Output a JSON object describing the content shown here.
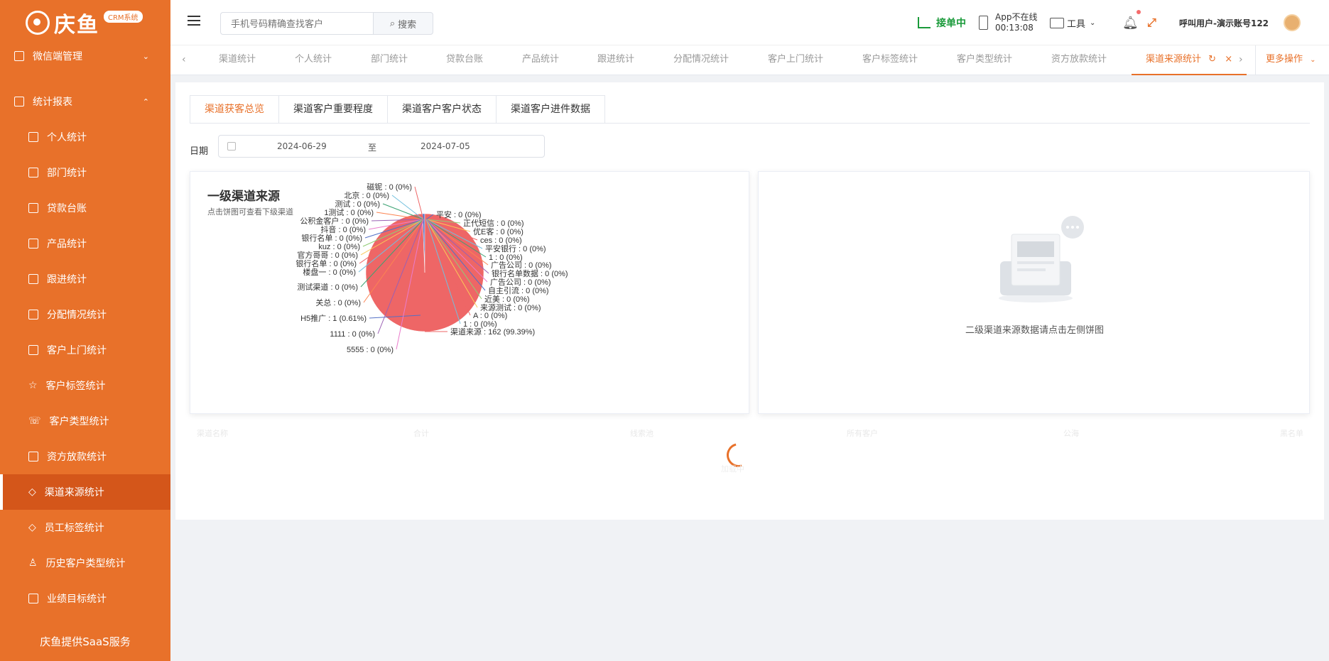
{
  "sidebar": {
    "brand": "庆鱼",
    "badge": "CRM系统",
    "groups": [
      {
        "label": "微信端管理",
        "arrow": "⌄"
      },
      {
        "label": "统计报表",
        "arrow": "⌃"
      }
    ],
    "items": [
      {
        "label": "个人统计"
      },
      {
        "label": "部门统计"
      },
      {
        "label": "贷款台账"
      },
      {
        "label": "产品统计"
      },
      {
        "label": "跟进统计"
      },
      {
        "label": "分配情况统计"
      },
      {
        "label": "客户上门统计"
      },
      {
        "label": "客户标签统计"
      },
      {
        "label": "客户类型统计"
      },
      {
        "label": "资方放款统计"
      },
      {
        "label": "渠道来源统计"
      },
      {
        "label": "员工标签统计"
      },
      {
        "label": "历史客户类型统计"
      },
      {
        "label": "业绩目标统计"
      }
    ],
    "footer": "庆鱼提供SaaS服务"
  },
  "header": {
    "search_placeholder": "手机号码精确查找客户",
    "search_button": "搜索",
    "status": "接单中",
    "app_status_line1": "App不在线",
    "app_status_line2": "00:13:08",
    "tools": "工具",
    "user": "呼叫用户-演示账号122"
  },
  "tabs": {
    "items": [
      {
        "label": "渠道统计"
      },
      {
        "label": "个人统计"
      },
      {
        "label": "部门统计"
      },
      {
        "label": "贷款台账"
      },
      {
        "label": "产品统计"
      },
      {
        "label": "跟进统计"
      },
      {
        "label": "分配情况统计"
      },
      {
        "label": "客户上门统计"
      },
      {
        "label": "客户标签统计"
      },
      {
        "label": "客户类型统计"
      },
      {
        "label": "资方放款统计"
      },
      {
        "label": "渠道来源统计"
      }
    ],
    "more": "更多操作"
  },
  "content": {
    "subtabs": [
      {
        "label": "渠道获客总览"
      },
      {
        "label": "渠道客户重要程度"
      },
      {
        "label": "渠道客户客户状态"
      },
      {
        "label": "渠道客户进件数据"
      }
    ],
    "date_label": "日期",
    "date_start": "2024-06-29",
    "date_sep": "至",
    "date_end": "2024-07-05",
    "chart_title": "一级渠道来源",
    "chart_subtitle": "点击饼图可查看下级渠道",
    "empty_text": "二级渠道来源数据请点击左侧饼图",
    "table_headers": [
      "渠道名称",
      "合计",
      "线索池",
      "所有客户",
      "公海",
      "黑名单"
    ],
    "loading_text": "加载中"
  },
  "chart_data": {
    "type": "pie",
    "title": "一级渠道来源",
    "subtitle": "点击饼图可查看下级渠道",
    "colors": {
      "main": "#ee6666",
      "secondary": "#5470c6"
    },
    "slices": [
      {
        "name": "渠道来源",
        "value": 162,
        "percent": "99.39%"
      },
      {
        "name": "H5推广",
        "value": 1,
        "percent": "0.61%"
      },
      {
        "name": "磁铌",
        "value": 0,
        "percent": "0%"
      },
      {
        "name": "北京",
        "value": 0,
        "percent": "0%"
      },
      {
        "name": "测试",
        "value": 0,
        "percent": "0%"
      },
      {
        "name": "1测试",
        "value": 0,
        "percent": "0%"
      },
      {
        "name": "公积金客户",
        "value": 0,
        "percent": "0%"
      },
      {
        "name": "抖音",
        "value": 0,
        "percent": "0%"
      },
      {
        "name": "银行名单",
        "value": 0,
        "percent": "0%"
      },
      {
        "name": "kuz",
        "value": 0,
        "percent": "0%"
      },
      {
        "name": "官方哥哥",
        "value": 0,
        "percent": "0%"
      },
      {
        "name": "银行名单",
        "value": 0,
        "percent": "0%"
      },
      {
        "name": "楼盘一",
        "value": 0,
        "percent": "0%"
      },
      {
        "name": "测试渠道",
        "value": 0,
        "percent": "0%"
      },
      {
        "name": "关总",
        "value": 0,
        "percent": "0%"
      },
      {
        "name": "1111",
        "value": 0,
        "percent": "0%"
      },
      {
        "name": "5555",
        "value": 0,
        "percent": "0%"
      },
      {
        "name": "平安",
        "value": 0,
        "percent": "0%"
      },
      {
        "name": "正代短信",
        "value": 0,
        "percent": "0%"
      },
      {
        "name": "优E客",
        "value": 0,
        "percent": "0%"
      },
      {
        "name": "ces",
        "value": 0,
        "percent": "0%"
      },
      {
        "name": "平安银行",
        "value": 0,
        "percent": "0%"
      },
      {
        "name": "1",
        "value": 0,
        "percent": "0%"
      },
      {
        "name": "广告公司",
        "value": 0,
        "percent": "0%"
      },
      {
        "name": "银行名单数据",
        "value": 0,
        "percent": "0%"
      },
      {
        "name": "广告公司",
        "value": 0,
        "percent": "0%"
      },
      {
        "name": "自主引流",
        "value": 0,
        "percent": "0%"
      },
      {
        "name": "近美",
        "value": 0,
        "percent": "0%"
      },
      {
        "name": "来源测试",
        "value": 0,
        "percent": "0%"
      },
      {
        "name": "A",
        "value": 0,
        "percent": "0%"
      },
      {
        "name": "1",
        "value": 0,
        "percent": "0%"
      }
    ]
  }
}
